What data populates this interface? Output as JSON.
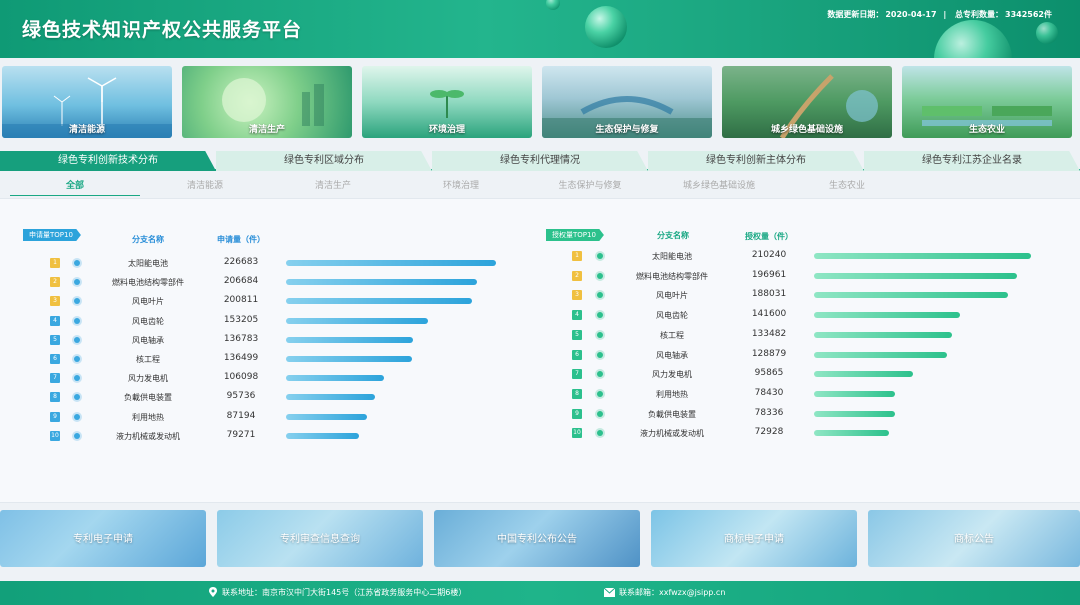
{
  "header": {
    "title": "绿色技术知识产权公共服务平台",
    "update_label": "数据更新日期：",
    "update_date": "2020-04-17",
    "separator": "|",
    "total_label": "总专利数量：",
    "total_value": "3342562件"
  },
  "categories": [
    {
      "label": "清洁能源"
    },
    {
      "label": "清洁生产"
    },
    {
      "label": "环境治理"
    },
    {
      "label": "生态保护与修复"
    },
    {
      "label": "城乡绿色基础设施"
    },
    {
      "label": "生态农业"
    }
  ],
  "tabs": [
    {
      "label": "绿色专利创新技术分布",
      "active": true
    },
    {
      "label": "绿色专利区域分布",
      "active": false
    },
    {
      "label": "绿色专利代理情况",
      "active": false
    },
    {
      "label": "绿色专利创新主体分布",
      "active": false
    },
    {
      "label": "绿色专利江苏企业名录",
      "active": false
    }
  ],
  "subtabs": [
    {
      "label": "全部",
      "active": true
    },
    {
      "label": "清洁能源",
      "active": false
    },
    {
      "label": "清洁生产",
      "active": false
    },
    {
      "label": "环境治理",
      "active": false
    },
    {
      "label": "生态保护与修复",
      "active": false
    },
    {
      "label": "城乡绿色基础设施",
      "active": false
    },
    {
      "label": "生态农业",
      "active": false
    }
  ],
  "chart_data": [
    {
      "type": "bar",
      "title": "申请量TOP10",
      "name_header": "分支名称",
      "value_header": "申请量（件）",
      "accent": "#2ca3db",
      "categories": [
        "太阳能电池",
        "燃料电池结构零部件",
        "风电叶片",
        "风电齿轮",
        "风电轴承",
        "核工程",
        "风力发电机",
        "负載供电装置",
        "利用地热",
        "液力机械或发动机"
      ],
      "values": [
        226683,
        206684,
        200811,
        153205,
        136783,
        136499,
        106098,
        95736,
        87194,
        79271
      ]
    },
    {
      "type": "bar",
      "title": "授权量TOP10",
      "name_header": "分支名称",
      "value_header": "授权量（件）",
      "accent": "#2cc18c",
      "categories": [
        "太阳能电池",
        "燃料电池结构零部件",
        "风电叶片",
        "风电齿轮",
        "核工程",
        "风电轴承",
        "风力发电机",
        "利用地热",
        "负載供电装置",
        "液力机械或发动机"
      ],
      "values": [
        210240,
        196961,
        188031,
        141600,
        133482,
        128879,
        95865,
        78430,
        78336,
        72928
      ]
    }
  ],
  "rank_colors": [
    "#f0c040",
    "#f0c040",
    "#f0c040",
    "#3aa8e0",
    "#3aa8e0",
    "#3aa8e0",
    "#3aa8e0",
    "#3aa8e0",
    "#3aa8e0",
    "#3aa8e0"
  ],
  "rank_colors_right": [
    "#f0c040",
    "#f0c040",
    "#f0c040",
    "#2cc08d",
    "#2cc08d",
    "#2cc08d",
    "#2cc08d",
    "#2cc08d",
    "#2cc08d",
    "#2cc08d"
  ],
  "services": [
    {
      "label": "专利电子申请"
    },
    {
      "label": "专利审查信息查询"
    },
    {
      "label": "中国专利公布公告"
    },
    {
      "label": "商标电子申请"
    },
    {
      "label": "商标公告"
    }
  ],
  "footer": {
    "address": "联系地址：南京市汉中门大街145号（江苏省政务服务中心二期6楼）",
    "email": "联系邮箱：xxfwzx@jsipp.cn"
  }
}
